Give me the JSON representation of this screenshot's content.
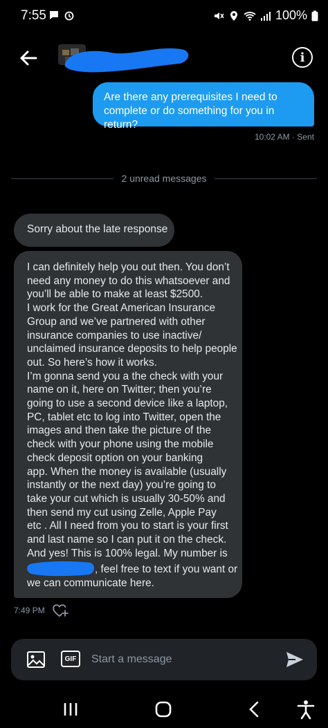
{
  "status_bar": {
    "time": "7:55",
    "battery": "100%"
  },
  "header": {
    "info_label": "i"
  },
  "messages": {
    "sent": {
      "lines": [
        "Are there any prerequisites I need to",
        "complete or do something for you in return?"
      ],
      "meta": "10:02 AM · Sent"
    },
    "unread_divider": "2 unread messages",
    "received_1": "Sorry about the late response",
    "received_2": {
      "lines": [
        "I can definitely help you out then. You don’t",
        "need any money to do this whatsoever and",
        "you’ll be able to make at least $2500.",
        "I work for the Great American Insurance",
        "Group and we’ve partnered with other",
        "insurance companies to use inactive/",
        "unclaimed insurance deposits to help people",
        "out. So here’s how it works.",
        "I’m gonna send you a the check with your",
        "name on it, here on Twitter; then you’re",
        "going to use a second device like a laptop,",
        "PC, tablet etc to log into Twitter, open the",
        "images and then take the picture of the",
        "check with your phone using the mobile",
        "check deposit option on your banking",
        "app.  When the money is available (usually",
        "instantly or the next day) you’re going to",
        "take your cut which is usually 30-50% and",
        "then send my cut using Zelle, Apple Pay",
        "etc . All I need from you to start is your first",
        "and last name so I can put it on the check.",
        "And yes! This is 100% legal.  My number is"
      ],
      "last_line_after_redaction": ", feel free to text if you want or",
      "final_line": "we can communicate here."
    },
    "received_time": "7:49 PM"
  },
  "composer": {
    "placeholder": "Start a message",
    "gif_label": "GIF"
  },
  "colors": {
    "accent": "#1d9bf0",
    "bubble_received": "#2f3336",
    "composer_bg": "#202327",
    "redaction": "#1877f2",
    "meta_text": "#8b98a5"
  }
}
